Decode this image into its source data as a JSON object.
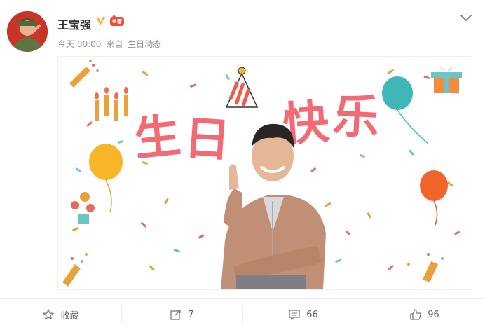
{
  "post": {
    "author": "王宝强",
    "time": "今天 00:00",
    "source_prefix": "来自",
    "source": "生日动态"
  },
  "image": {
    "headline": [
      "生",
      "日",
      "快",
      "乐"
    ]
  },
  "actions": {
    "favorite_label": "收藏",
    "repost_count": "7",
    "comment_count": "66",
    "like_count": "96"
  },
  "colors": {
    "title_red": "#f26a74",
    "verified_gold": "#f6b012",
    "vip_red": "#f04b3d",
    "meta_gray": "#939393"
  },
  "icons": [
    "avatar",
    "verified-icon",
    "vip-icon",
    "chevron-down-icon",
    "star-icon",
    "repost-icon",
    "comment-icon",
    "like-icon"
  ]
}
